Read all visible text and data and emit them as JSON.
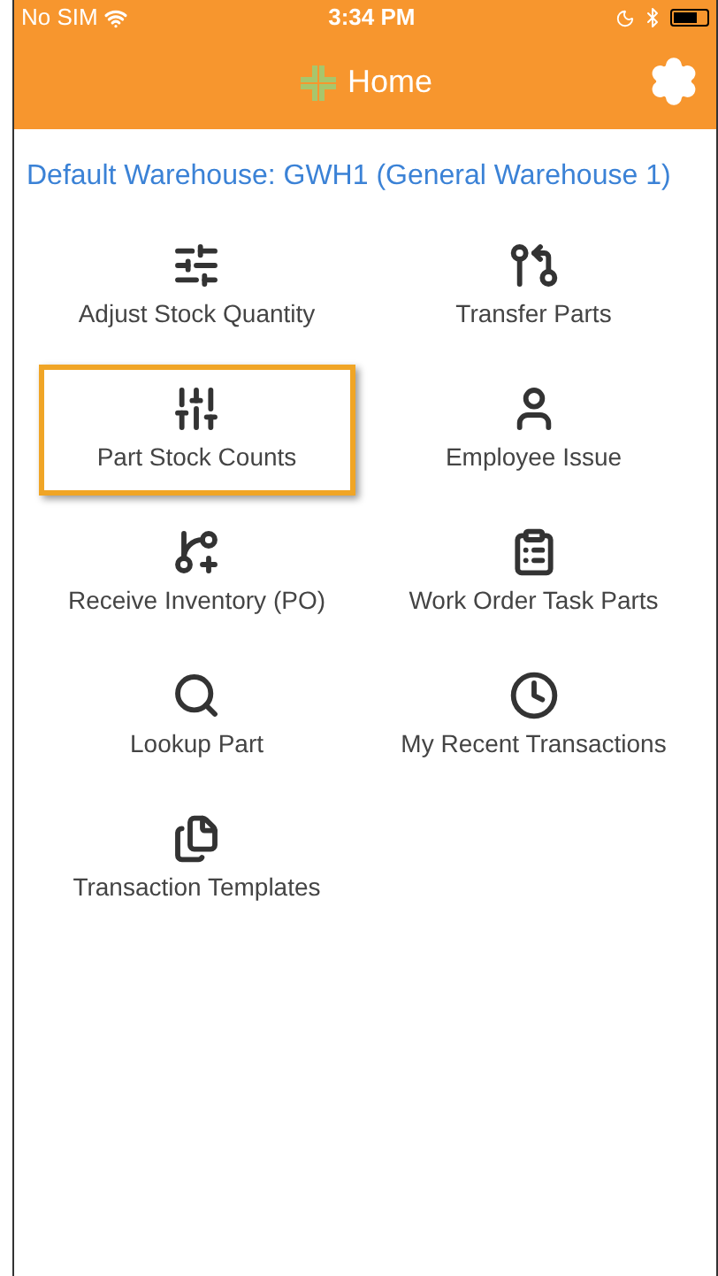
{
  "status_bar": {
    "carrier": "No SIM",
    "time": "3:34 PM"
  },
  "nav_bar": {
    "title": "Home"
  },
  "warehouse": "Default Warehouse: GWH1 (General Warehouse 1)",
  "tiles": [
    {
      "label": "Adjust Stock Quantity",
      "selected": false
    },
    {
      "label": "Transfer Parts",
      "selected": false
    },
    {
      "label": "Part Stock Counts",
      "selected": true
    },
    {
      "label": "Employee Issue",
      "selected": false
    },
    {
      "label": "Receive Inventory (PO)",
      "selected": false
    },
    {
      "label": "Work Order Task Parts",
      "selected": false
    },
    {
      "label": "Lookup Part",
      "selected": false
    },
    {
      "label": "My Recent Transactions",
      "selected": false
    },
    {
      "label": "Transaction Templates",
      "selected": false
    }
  ]
}
